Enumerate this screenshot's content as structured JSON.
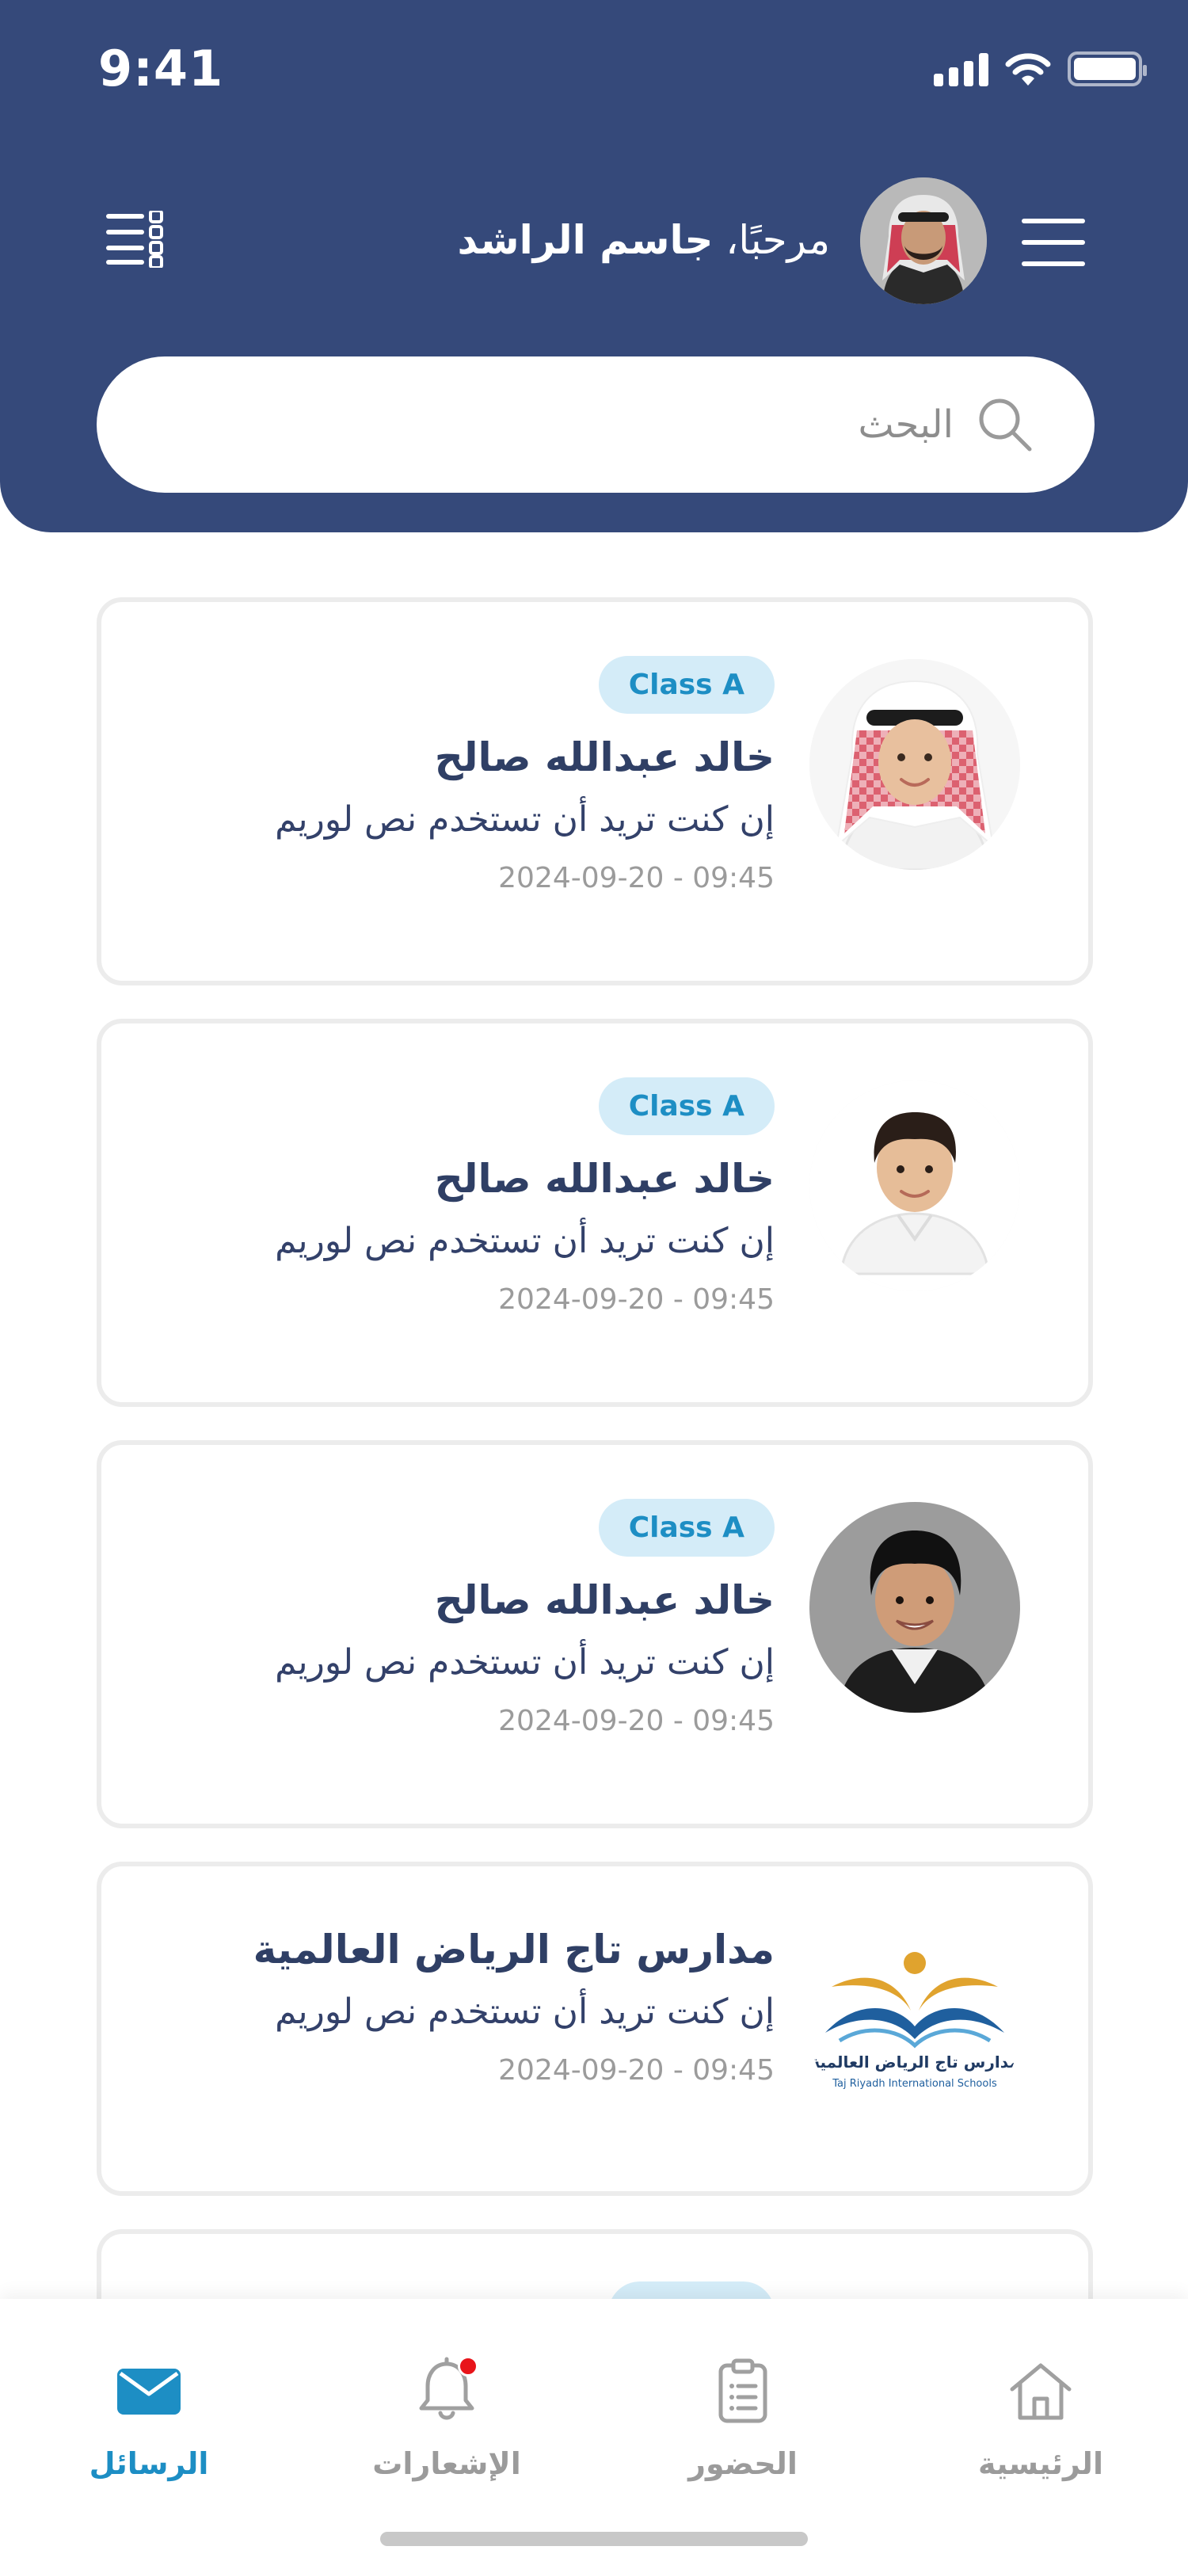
{
  "status": {
    "time": "9:41"
  },
  "header": {
    "greeting_prefix": "مرحبًا، ",
    "user_name": "جاسم الراشد"
  },
  "search": {
    "placeholder": "البحث"
  },
  "messages": [
    {
      "badge": "Class A",
      "sender": "خالد عبدالله صالح",
      "preview": "إن كنت تريد أن تستخدم نص لوريم",
      "timestamp": "2024-09-20 - 09:45",
      "avatar": "student-girl"
    },
    {
      "badge": "Class A",
      "sender": "خالد عبدالله صالح",
      "preview": "إن كنت تريد أن تستخدم نص لوريم",
      "timestamp": "2024-09-20 - 09:45",
      "avatar": "student-boy"
    },
    {
      "badge": "Class A",
      "sender": "خالد عبدالله صالح",
      "preview": "إن كنت تريد أن تستخدم نص لوريم",
      "timestamp": "2024-09-20 - 09:45",
      "avatar": "student-boy-2"
    },
    {
      "sender": "مدارس تاج الرياض العالمية",
      "preview": "إن كنت تريد أن تستخدم نص لوريم",
      "timestamp": "2024-09-20 - 09:45",
      "avatar": "school-logo",
      "logo_text_ar": "مدارس تاج الرياض العالمية",
      "logo_text_en": "Taj Riyadh International Schools"
    }
  ],
  "tabs": [
    {
      "label": "الرسائل",
      "icon": "envelope-icon",
      "active": true
    },
    {
      "label": "الإشعارات",
      "icon": "bell-icon",
      "active": false,
      "has_dot": true
    },
    {
      "label": "الحضور",
      "icon": "clipboard-icon",
      "active": false
    },
    {
      "label": "الرئيسية",
      "icon": "home-icon",
      "active": false
    }
  ],
  "colors": {
    "header_bg": "#35497a",
    "accent": "#1d8ec4",
    "badge_bg": "#d4ecf8",
    "notification_dot": "#e8141a"
  }
}
